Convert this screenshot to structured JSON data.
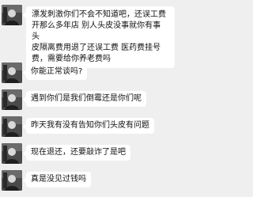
{
  "chat": {
    "messages": [
      {
        "lines": [
          "漂发刺激你们不会不知道吧，还误工费",
          "开那么多年店 别人头皮没事就你有事 头",
          "皮隔离费用退了还误工费 医药费挂号",
          "费，需要给你养老费吗"
        ]
      },
      {
        "text": "你能正常谈吗?"
      },
      {
        "text": "遇到你们是我们倒霉还是你们呢"
      },
      {
        "text": "昨天我有没有告知你们头皮有问题"
      },
      {
        "text": "现在退还，还要敲诈了是吧"
      },
      {
        "text": "真是没见过钱吗"
      }
    ]
  }
}
